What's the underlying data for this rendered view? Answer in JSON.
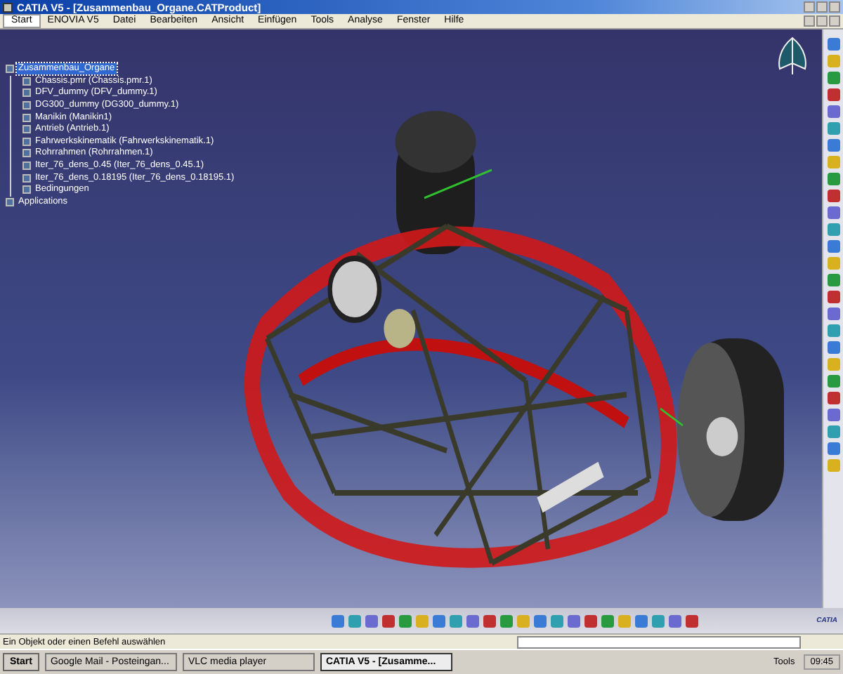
{
  "window": {
    "title": "CATIA V5 - [Zusammenbau_Organe.CATProduct]"
  },
  "menu": [
    {
      "label": "Start",
      "selected": true
    },
    {
      "label": "ENOVIA V5",
      "selected": false
    },
    {
      "label": "Datei",
      "selected": false
    },
    {
      "label": "Bearbeiten",
      "selected": false
    },
    {
      "label": "Ansicht",
      "selected": false
    },
    {
      "label": "Einfügen",
      "selected": false
    },
    {
      "label": "Tools",
      "selected": false
    },
    {
      "label": "Analyse",
      "selected": false
    },
    {
      "label": "Fenster",
      "selected": false
    },
    {
      "label": "Hilfe",
      "selected": false
    }
  ],
  "tree": [
    {
      "label": "Zusammenbau_Organe",
      "selected": true,
      "children": [
        {
          "label": "Chassis.pmr (Chassis.pmr.1)",
          "selected": false
        },
        {
          "label": "DFV_dummy (DFV_dummy.1)",
          "selected": false
        },
        {
          "label": "DG300_dummy (DG300_dummy.1)",
          "selected": false
        },
        {
          "label": "Manikin (Manikin1)",
          "selected": false
        },
        {
          "label": "Antrieb (Antrieb.1)",
          "selected": false
        },
        {
          "label": "Fahrwerkskinematik (Fahrwerkskinematik.1)",
          "selected": false
        },
        {
          "label": "Rohrrahmen (Rohrrahmen.1)",
          "selected": false
        },
        {
          "label": "Iter_76_dens_0.45 (Iter_76_dens_0.45.1)",
          "selected": false
        },
        {
          "label": "Iter_76_dens_0.18195 (Iter_76_dens_0.18195.1)",
          "selected": false
        },
        {
          "label": "Bedingungen",
          "selected": false
        }
      ]
    },
    {
      "label": "Applications",
      "selected": false
    }
  ],
  "logo": {
    "text": "CATIA"
  },
  "status_bar": {
    "message": "Ein Objekt oder einen Befehl auswählen"
  },
  "taskbar": {
    "start": "Start",
    "tasks": [
      {
        "label": "Google Mail - Posteingan...",
        "selected": false
      },
      {
        "label": "VLC media player",
        "selected": false
      },
      {
        "label": "CATIA V5 - [Zusamme...",
        "selected": true
      }
    ],
    "tray_label": "Tools",
    "clock": "09:45"
  }
}
